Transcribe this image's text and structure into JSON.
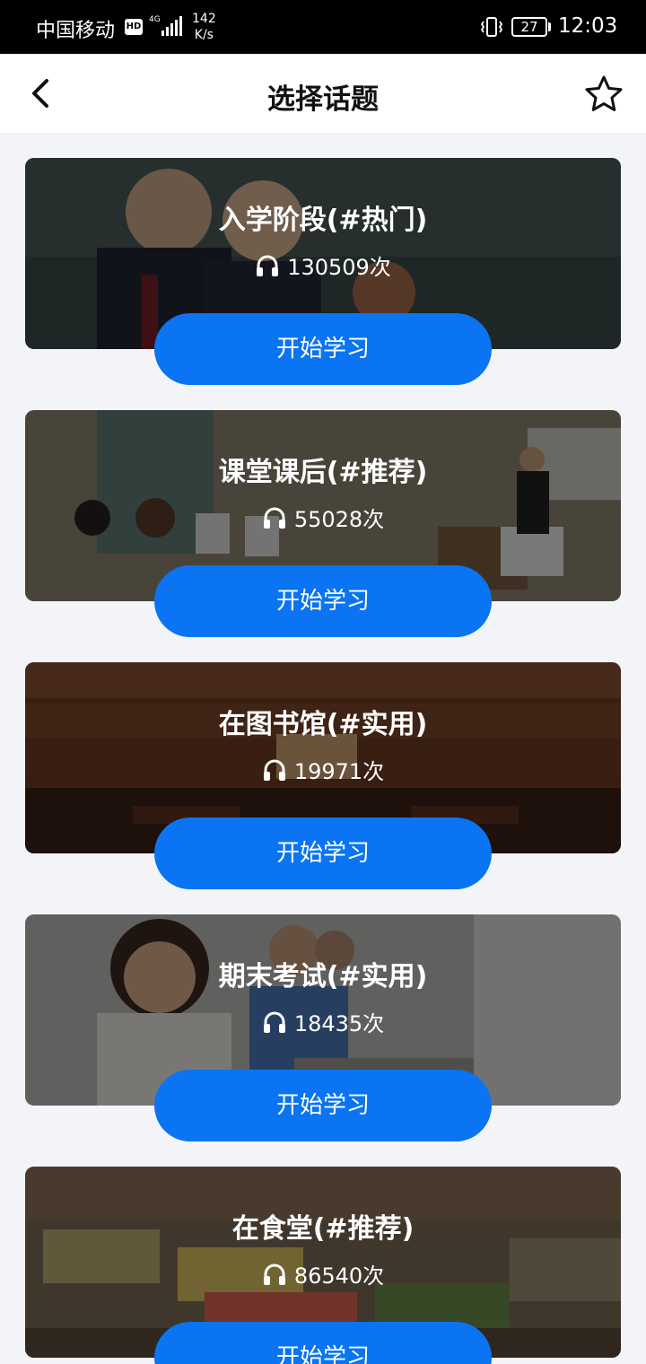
{
  "status_bar": {
    "carrier": "中国移动",
    "hd": "HD",
    "network": "4G",
    "speed_value": "142",
    "speed_unit": "K/s",
    "battery": "27",
    "time": "12:03"
  },
  "header": {
    "title": "选择话题",
    "back_icon": "chevron-left-icon",
    "favorite_icon": "star-outline-icon"
  },
  "topics": [
    {
      "title": "入学阶段(#热门)",
      "count": "130509次",
      "button": "开始学习"
    },
    {
      "title": "课堂课后(#推荐)",
      "count": "55028次",
      "button": "开始学习"
    },
    {
      "title": "在图书馆(#实用)",
      "count": "19971次",
      "button": "开始学习"
    },
    {
      "title": "期末考试(#实用)",
      "count": "18435次",
      "button": "开始学习"
    },
    {
      "title": "在食堂(#推荐)",
      "count": "86540次",
      "button": "开始学习"
    }
  ],
  "colors": {
    "accent": "#0a74f2",
    "background": "#f2f4f8"
  }
}
